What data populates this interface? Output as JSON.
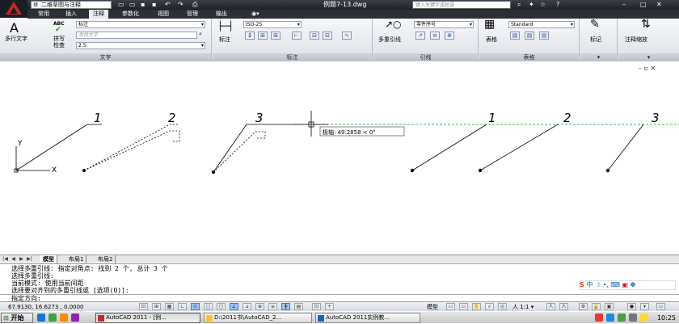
{
  "title_bar": {
    "workspace": "二维草图与注释",
    "document_title": "例题7-13.dwg",
    "search_placeholder": "键入关键字或短语"
  },
  "tabs": [
    "常用",
    "插入",
    "注释",
    "参数化",
    "视图",
    "管理",
    "输出"
  ],
  "active_tab": "注释",
  "ribbon": {
    "text_panel": {
      "title": "文字",
      "mtext_label": "多行文字",
      "spell_icon_text": "ABC",
      "spell_label": "拼写\n检查",
      "style_value": "标注",
      "find_placeholder": "查找文字",
      "height_value": "2.5"
    },
    "dim_panel": {
      "title": "标注",
      "dim_label": "标注",
      "style_value": "ISO-25"
    },
    "leader_panel": {
      "title": "引线",
      "mleader_label": "多重引线",
      "style_value": "零件序号"
    },
    "table_panel": {
      "title": "表格",
      "table_label": "表格",
      "style_value": "Standard"
    },
    "markup_panel": {
      "title": "",
      "label": "标记"
    },
    "scale_panel": {
      "title": "",
      "label": "注释缩放"
    }
  },
  "drawing": {
    "leader_numbers": [
      "1",
      "2",
      "3",
      "1",
      "2",
      "3"
    ],
    "tooltip": "极轴: 49.2858 < 0°",
    "ucs_x": "X",
    "ucs_y": "Y"
  },
  "layout_tabs": [
    "模型",
    "布局1",
    "布局2"
  ],
  "active_layout": "模型",
  "command_history": [
    "选择多重引线: 指定对角点: 找到 2 个, 总计 3 个",
    "选择多重引线:",
    "当前模式: 使用当前间距",
    "选择要对齐到的多重引线或 [选项(O)]:"
  ],
  "command_prompt": "指定方向:",
  "status_bar": {
    "coordinates": "67.9130, 16.6273 , 0.0000",
    "model_label": "模型",
    "scale": "1:1"
  },
  "taskbar": {
    "start_label": "开始",
    "tasks": [
      "AutoCAD 2011 - [例...",
      "D:\\2011书\\AutoCAD_2...",
      "AutoCAD 2011实例教..."
    ],
    "clock": "10:25"
  },
  "colors": {
    "title_bg": "#1e2229",
    "ribbon_bg": "#dde1e8",
    "polar_track": "#2e8b2e",
    "leader_line": "#000000"
  }
}
